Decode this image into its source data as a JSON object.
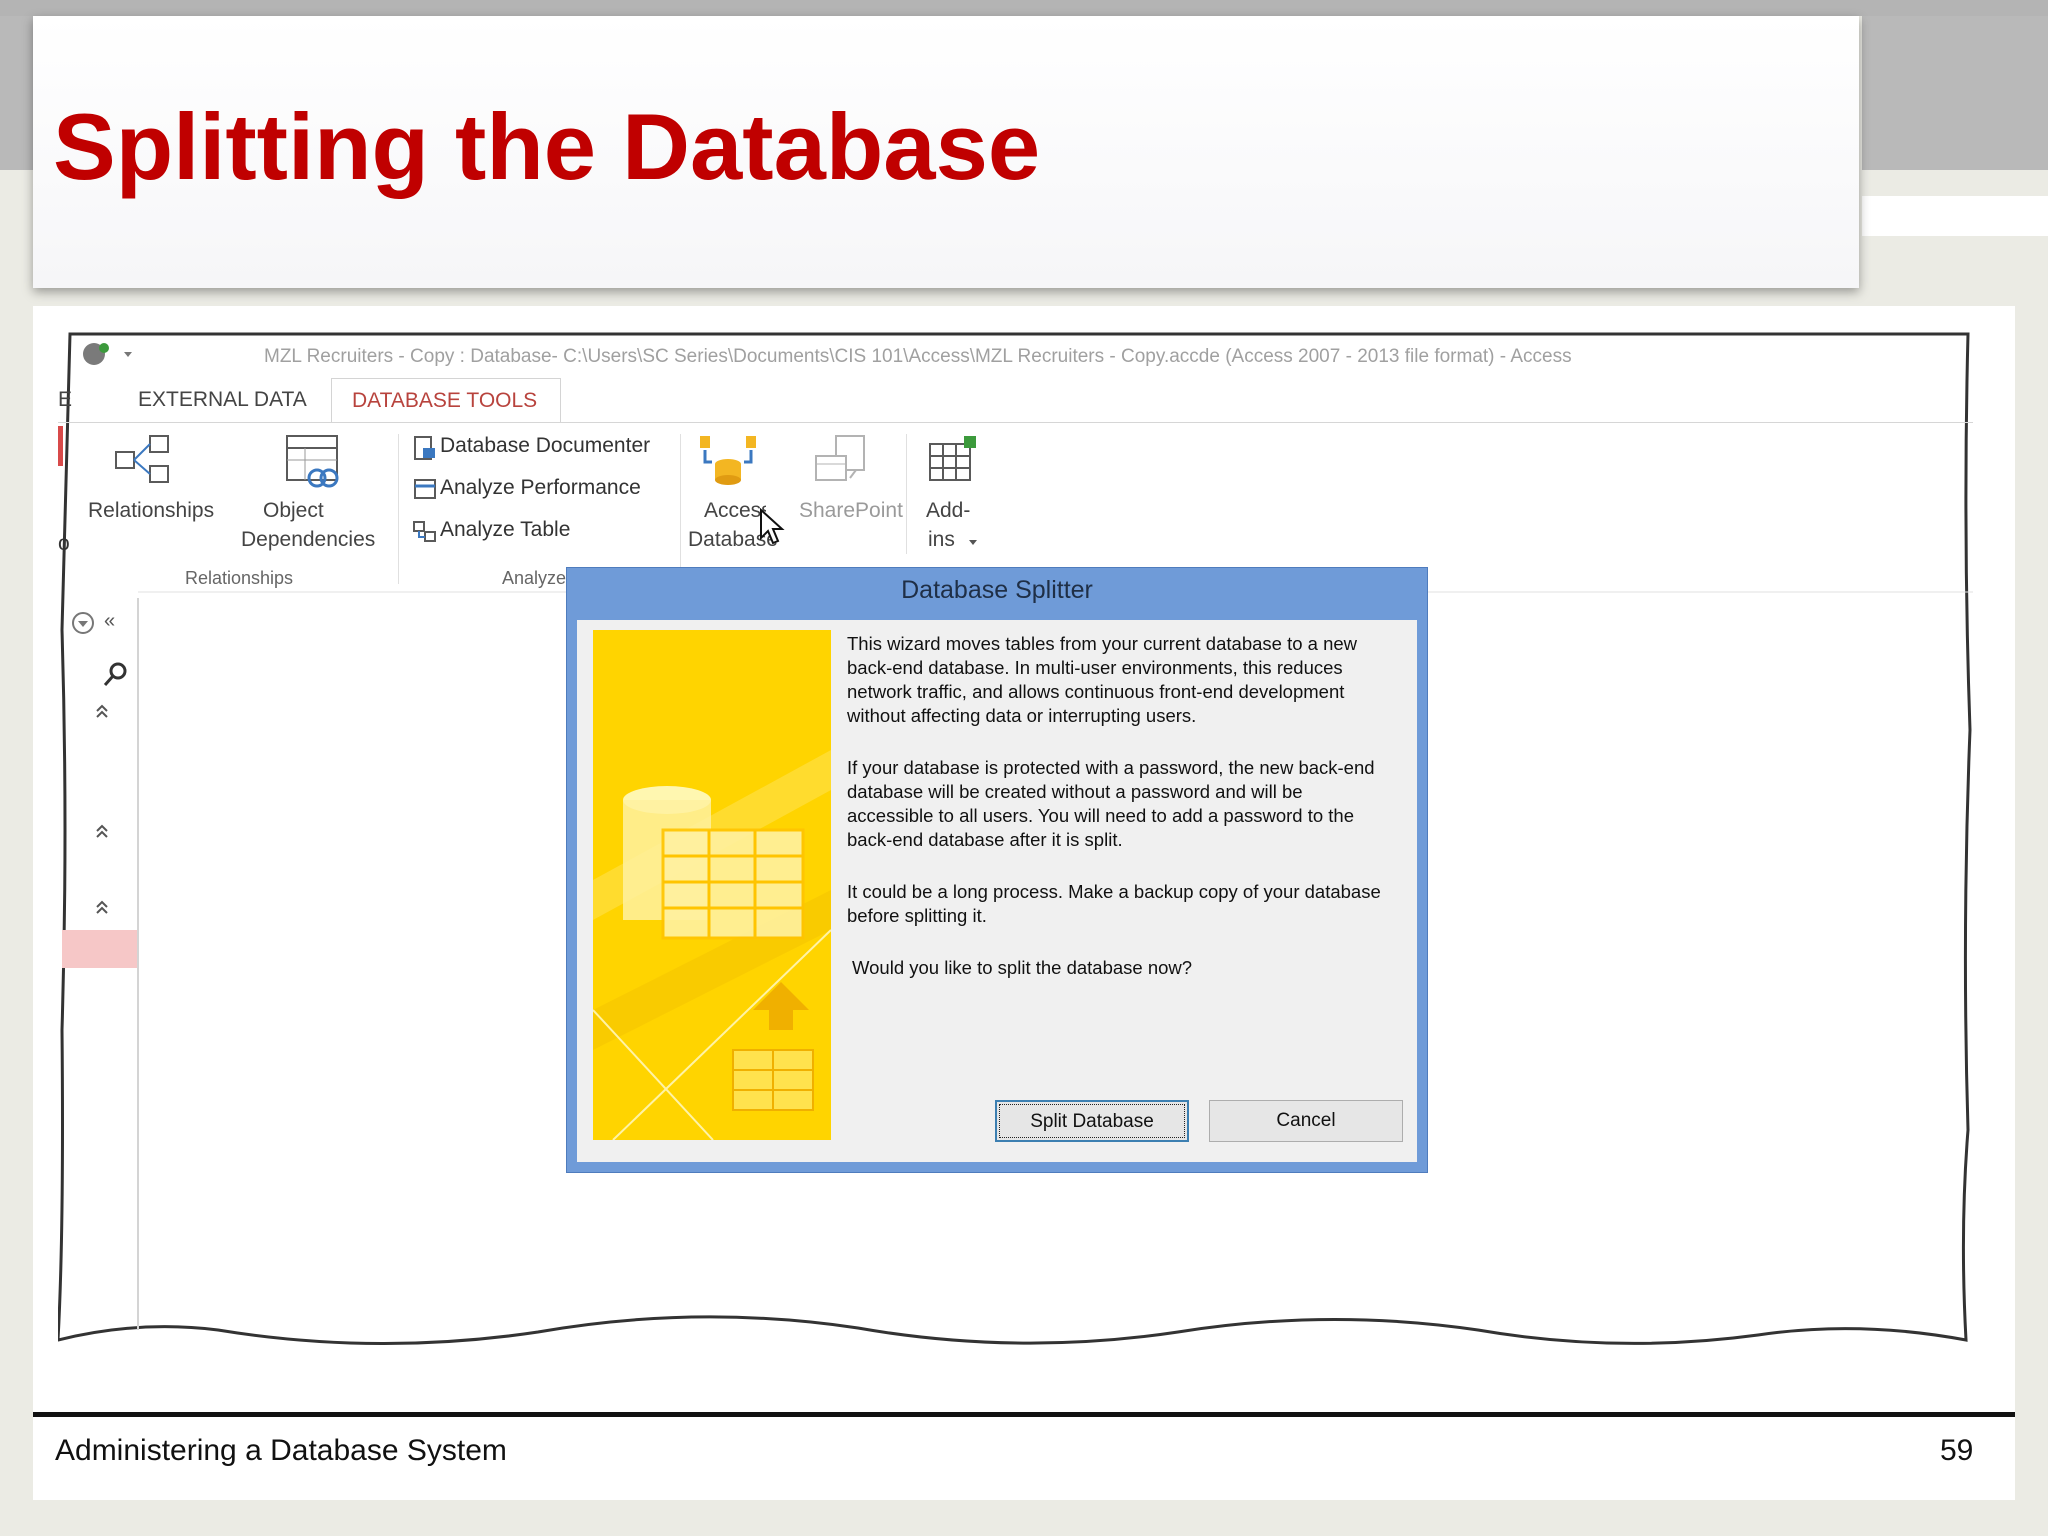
{
  "slide": {
    "title": "Splitting the Database",
    "footer": "Administering a Database System",
    "page_number": "59"
  },
  "window": {
    "title": "MZL Recruiters - Copy : Database- C:\\Users\\SC Series\\Documents\\CIS 101\\Access\\MZL Recruiters - Copy.accde (Access 2007 - 2013 file format) - Access"
  },
  "ribbon": {
    "tabs": [
      {
        "label": "E"
      },
      {
        "label": "EXTERNAL DATA"
      },
      {
        "label": "DATABASE TOOLS",
        "active": true
      }
    ],
    "groups": {
      "relationships": {
        "label": "Relationships",
        "relationships_button": "Relationships",
        "object_dependencies_line1": "Object",
        "object_dependencies_line2": "Dependencies"
      },
      "analyze": {
        "label": "Analyze",
        "database_documenter": "Database Documenter",
        "analyze_performance": "Analyze Performance",
        "analyze_table": "Analyze Table"
      },
      "move_data": {
        "access_database_line1": "Access",
        "access_database_line2": "Database",
        "sharepoint": "SharePoint"
      },
      "addins": {
        "line1": "Add-",
        "line2": "ins"
      }
    },
    "left_cut_letter": "o"
  },
  "dialog": {
    "title": "Database Splitter",
    "paragraph1": "This wizard moves tables from your current database to a new back-end database. In multi-user environments, this reduces network traffic, and allows continuous front-end development without affecting data or interrupting users.",
    "paragraph2": "If your database is protected with a password, the new back-end database will be created without a password and will be accessible to all users.  You will need to add a password to the back-end database after it is split.",
    "paragraph3": "It could be a long process. Make a backup copy of your database before splitting it.",
    "question": "Would you like to split the database now?",
    "split_button": "Split Database",
    "cancel_button": "Cancel"
  },
  "nav_pane": {
    "collapse_glyph": "«"
  },
  "colors": {
    "title_red": "#c00000",
    "dialog_frame": "#6f9bd8",
    "active_tab": "#b8433d",
    "art_yellow": "#ffd400"
  }
}
